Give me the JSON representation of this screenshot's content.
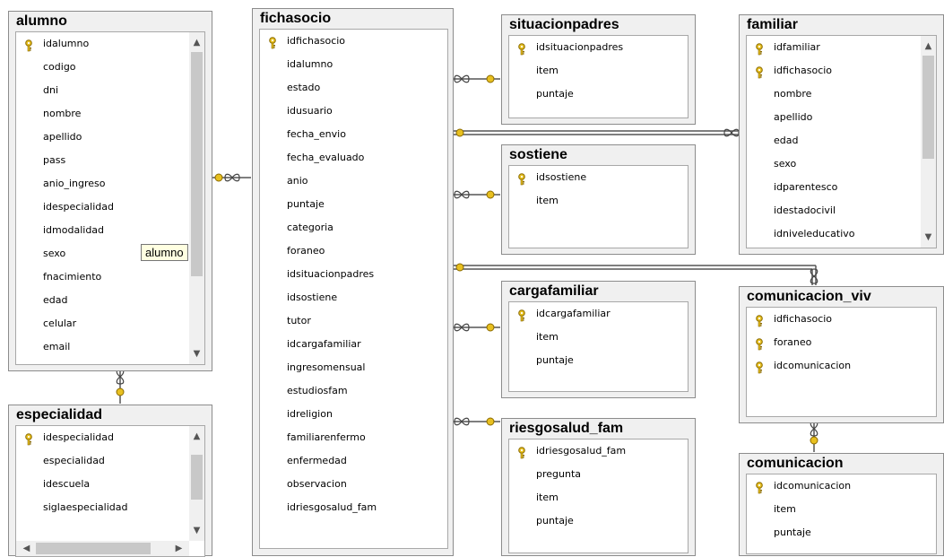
{
  "tables": {
    "alumno": {
      "title": "alumno",
      "columns": [
        {
          "name": "idalumno",
          "key": true
        },
        {
          "name": "codigo"
        },
        {
          "name": "dni"
        },
        {
          "name": "nombre"
        },
        {
          "name": "apellido"
        },
        {
          "name": "pass"
        },
        {
          "name": "anio_ingreso"
        },
        {
          "name": "idespecialidad"
        },
        {
          "name": "idmodalidad"
        },
        {
          "name": "sexo"
        },
        {
          "name": "fnacimiento"
        },
        {
          "name": "edad"
        },
        {
          "name": "celular"
        },
        {
          "name": "email"
        }
      ]
    },
    "especialidad": {
      "title": "especialidad",
      "columns": [
        {
          "name": "idespecialidad",
          "key": true
        },
        {
          "name": "especialidad"
        },
        {
          "name": "idescuela"
        },
        {
          "name": "siglaespecialidad"
        }
      ]
    },
    "fichasocio": {
      "title": "fichasocio",
      "columns": [
        {
          "name": "idfichasocio",
          "key": true
        },
        {
          "name": "idalumno"
        },
        {
          "name": "estado"
        },
        {
          "name": "idusuario"
        },
        {
          "name": "fecha_envio"
        },
        {
          "name": "fecha_evaluado"
        },
        {
          "name": "anio"
        },
        {
          "name": "puntaje"
        },
        {
          "name": "categoria"
        },
        {
          "name": "foraneo"
        },
        {
          "name": "idsituacionpadres"
        },
        {
          "name": "idsostiene"
        },
        {
          "name": "tutor"
        },
        {
          "name": "idcargafamiliar"
        },
        {
          "name": "ingresomensual"
        },
        {
          "name": "estudiosfam"
        },
        {
          "name": "idreligion"
        },
        {
          "name": "familiarenfermo"
        },
        {
          "name": "enfermedad"
        },
        {
          "name": "observacion"
        },
        {
          "name": "idriesgosalud_fam"
        }
      ]
    },
    "situacionpadres": {
      "title": "situacionpadres",
      "columns": [
        {
          "name": "idsituacionpadres",
          "key": true
        },
        {
          "name": "item"
        },
        {
          "name": "puntaje"
        }
      ]
    },
    "sostiene": {
      "title": "sostiene",
      "columns": [
        {
          "name": "idsostiene",
          "key": true
        },
        {
          "name": "item"
        }
      ]
    },
    "cargafamiliar": {
      "title": "cargafamiliar",
      "columns": [
        {
          "name": "idcargafamiliar",
          "key": true
        },
        {
          "name": "item"
        },
        {
          "name": "puntaje"
        }
      ]
    },
    "riesgosalud_fam": {
      "title": "riesgosalud_fam",
      "columns": [
        {
          "name": "idriesgosalud_fam",
          "key": true
        },
        {
          "name": "pregunta"
        },
        {
          "name": "item"
        },
        {
          "name": "puntaje"
        }
      ]
    },
    "familiar": {
      "title": "familiar",
      "columns": [
        {
          "name": "idfamiliar",
          "key": true
        },
        {
          "name": "idfichasocio",
          "key": true
        },
        {
          "name": "nombre"
        },
        {
          "name": "apellido"
        },
        {
          "name": "edad"
        },
        {
          "name": "sexo"
        },
        {
          "name": "idparentesco"
        },
        {
          "name": "idestadocivil"
        },
        {
          "name": "idniveleducativo"
        }
      ]
    },
    "comunicacion_viv": {
      "title": "comunicacion_viv",
      "columns": [
        {
          "name": "idfichasocio",
          "key": true
        },
        {
          "name": "foraneo",
          "key": true
        },
        {
          "name": "idcomunicacion",
          "key": true
        }
      ]
    },
    "comunicacion": {
      "title": "comunicacion",
      "columns": [
        {
          "name": "idcomunicacion",
          "key": true
        },
        {
          "name": "item"
        },
        {
          "name": "puntaje"
        }
      ]
    }
  },
  "tooltip": {
    "text": "alumno"
  },
  "colors": {
    "key": "#e0c020",
    "line": "#505050",
    "box": "#f0f0f0"
  }
}
